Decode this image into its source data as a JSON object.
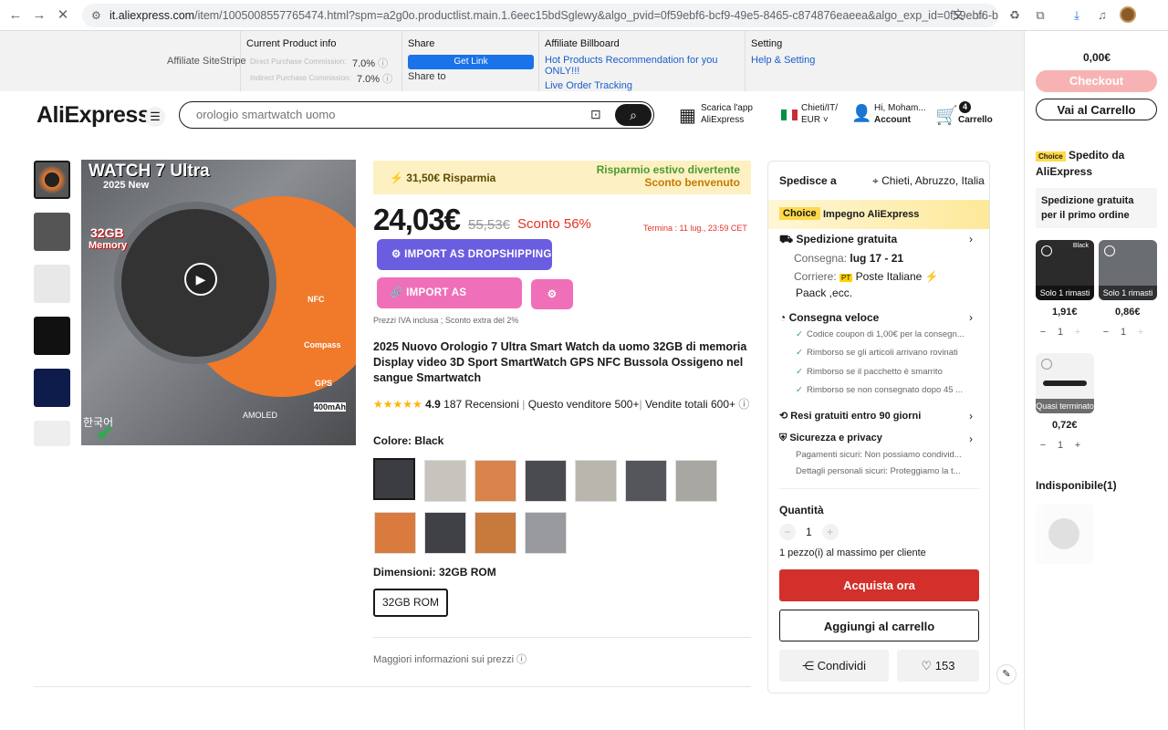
{
  "browser": {
    "url_host": "it.aliexpress.com",
    "url_path": "/item/1005008557765474.html?spm=a2g0o.productlist.main.1.6eec15bdSglewy&algo_pvid=0f59ebf6-bcf9-49e5-8465-c874876eaeea&algo_exp_id=0f59ebf6-b..."
  },
  "stripe": {
    "label": "Affiliate SiteStripe",
    "current_title": "Current Product info",
    "direct_label": "Direct Purchase Commission:",
    "direct_val": "7.0%",
    "indirect_label": "Indirect Purchase Commission:",
    "indirect_val": "7.0%",
    "share_title": "Share",
    "get_link": "Get Link",
    "share_to": "Share to",
    "billboard_title": "Affiliate Billboard",
    "hot_products": "Hot Products Recommendation for you ONLY!!!",
    "live_tracking": "Live Order Tracking",
    "setting_title": "Setting",
    "help_setting": "Help & Setting"
  },
  "header": {
    "logo_a": "Ali",
    "logo_b": "Express",
    "search_placeholder": "orologio smartwatch uomo",
    "app_l1": "Scarica l'app",
    "app_l2": "AliExpress",
    "region_l1": "Chieti/IT/",
    "region_l2": "EUR ˅",
    "account_l1": "Hi, Moham...",
    "account_l2": "Account",
    "cart_count": "4",
    "cart_label": "Carrello"
  },
  "gallery": {
    "img_title": "WATCH 7 Ultra",
    "img_sub": "2025 New",
    "img_mem": "32GB",
    "img_mem2": "Memory",
    "nfc": "NFC",
    "compass": "Compass",
    "gps": "GPS",
    "battery": "400mAh",
    "amoled": "AMOLED",
    "korean": "한국어"
  },
  "product": {
    "savings": "31,50€ Risparmia",
    "promo_l1": "Risparmio estivo divertente",
    "promo_l2": "Sconto benvenuto",
    "price": "24,03€",
    "old_price": "55,53€",
    "discount": "Sconto 56%",
    "ends": "Termina :  11 lug., 23:59 CET",
    "import_dropship": "IMPORT AS DROPSHIPPING",
    "import_affiliate": "IMPORT AS AFFILIATE",
    "tax_note": "Prezzi IVA inclusa ; Sconto extra del 2%",
    "title": "2025 Nuovo Orologio 7 Ultra Smart Watch da uomo 32GB di memoria Display video 3D Sport SmartWatch GPS NFC Bussola Ossigeno nel sangue Smartwatch",
    "rating": "4.9",
    "reviews": "187 Recensioni",
    "seller": "Questo venditore 500+",
    "sales": "Vendite totali 600+",
    "color_label": "Colore: Black",
    "size_label": "Dimensioni: 32GB ROM",
    "size_option": "32GB ROM",
    "more_info": "Maggiori informazioni sui prezzi"
  },
  "buybox": {
    "ships_to": "Spedisce a",
    "location": "Chieti, Abruzzo, Italia",
    "choice_badge": "Choice",
    "choice_text": "Impegno AliExpress",
    "free_ship": "Spedizione gratuita",
    "delivery_label": "Consegna:",
    "delivery_val": "lug 17 - 21",
    "carrier_label": "Corriere:",
    "carrier_badge": "PT",
    "carrier_val": "Poste Italiane",
    "carrier_val2": "Paack ,ecc.",
    "fast": "Consegna veloce",
    "f1": "Codice coupon di 1,00€ per la consegn...",
    "f2": "Rimborso se gli articoli arrivano rovinati",
    "f3": "Rimborso se il pacchetto è smarrito",
    "f4": "Rimborso se non consegnato dopo 45 ...",
    "returns": "Resi gratuiti entro 90 giorni",
    "security": "Sicurezza e privacy",
    "s1": "Pagamenti sicuri: Non possiamo condivid...",
    "s2": "Dettagli personali sicuri: Proteggiamo la t...",
    "qty_label": "Quantità",
    "qty": "1",
    "qty_note": "1 pezzo(i) al massimo per cliente",
    "buy_now": "Acquista ora",
    "add_cart": "Aggiungi al carrello",
    "share": "Condividi",
    "likes": "153"
  },
  "cart_panel": {
    "total": "0,00€",
    "checkout": "Checkout",
    "go_cart": "Vai al Carrello",
    "choice": "Choice",
    "shipped_from": "Spedito da AliExpress",
    "free_ship": "Spedizione gratuita per il primo ordine",
    "items": [
      {
        "tag": "Solo 1 rimasti",
        "price": "1,91€",
        "qty": "1",
        "variant": "Black"
      },
      {
        "tag": "Solo 1 rimasti",
        "price": "0,86€",
        "qty": "1"
      },
      {
        "tag": "Quasi terminato",
        "price": "0,72€",
        "qty": "1"
      }
    ],
    "unavailable": "Indisponibile(1)"
  },
  "colors": {
    "red": "#e43225",
    "buy": "#d3302b",
    "promo": "#4a9c2d",
    "affiliate": "#f06fb9",
    "dropship": "#6b5de0"
  }
}
